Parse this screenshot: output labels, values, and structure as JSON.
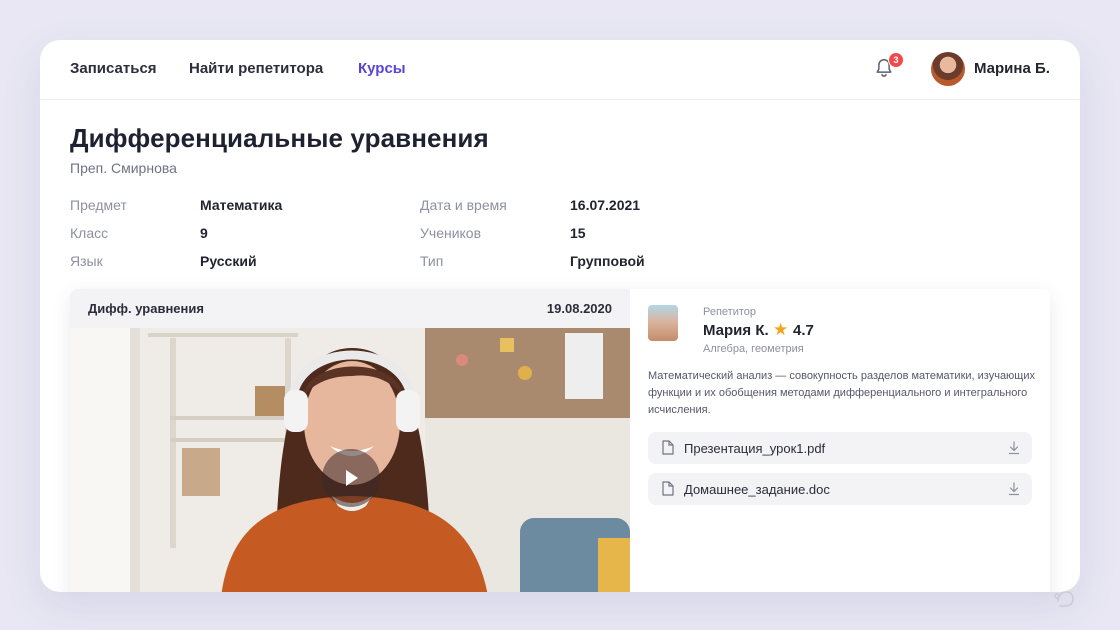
{
  "nav": {
    "items": [
      {
        "label": "Записаться",
        "active": false
      },
      {
        "label": "Найти репетитора",
        "active": false
      },
      {
        "label": "Курсы",
        "active": true
      }
    ],
    "notifications_count": "3",
    "user_name": "Марина Б."
  },
  "course": {
    "title": "Дифференциальные уравнения",
    "teacher": "Преп. Смирнова",
    "meta": [
      {
        "label": "Предмет",
        "value": "Математика"
      },
      {
        "label": "Класс",
        "value": "9"
      },
      {
        "label": "Язык",
        "value": "Русский"
      },
      {
        "label": "Дата и время",
        "value": "16.07.2021"
      },
      {
        "label": "Учеников",
        "value": "15"
      },
      {
        "label": "Тип",
        "value": "Групповой"
      }
    ]
  },
  "video": {
    "title": "Дифф. уравнения",
    "date": "19.08.2020"
  },
  "tutor": {
    "role": "Репетитор",
    "name": "Мария К.",
    "rating": "4.7",
    "subjects": "Алгебра, геометрия",
    "description": "Математический анализ — совокупность разделов математики, изучающих функции и их обобщения методами дифференциального и интегрального исчисления."
  },
  "files": [
    {
      "name": "Презентация_урок1.pdf"
    },
    {
      "name": "Домашнее_задание.doc"
    }
  ],
  "colors": {
    "accent": "#5a44d6",
    "badge": "#ef4a4a",
    "star": "#f3a41b",
    "page_bg": "#e8e7f3"
  },
  "icons": [
    "bell-icon",
    "play-icon",
    "star-icon",
    "file-icon",
    "download-icon",
    "logo-icon"
  ]
}
